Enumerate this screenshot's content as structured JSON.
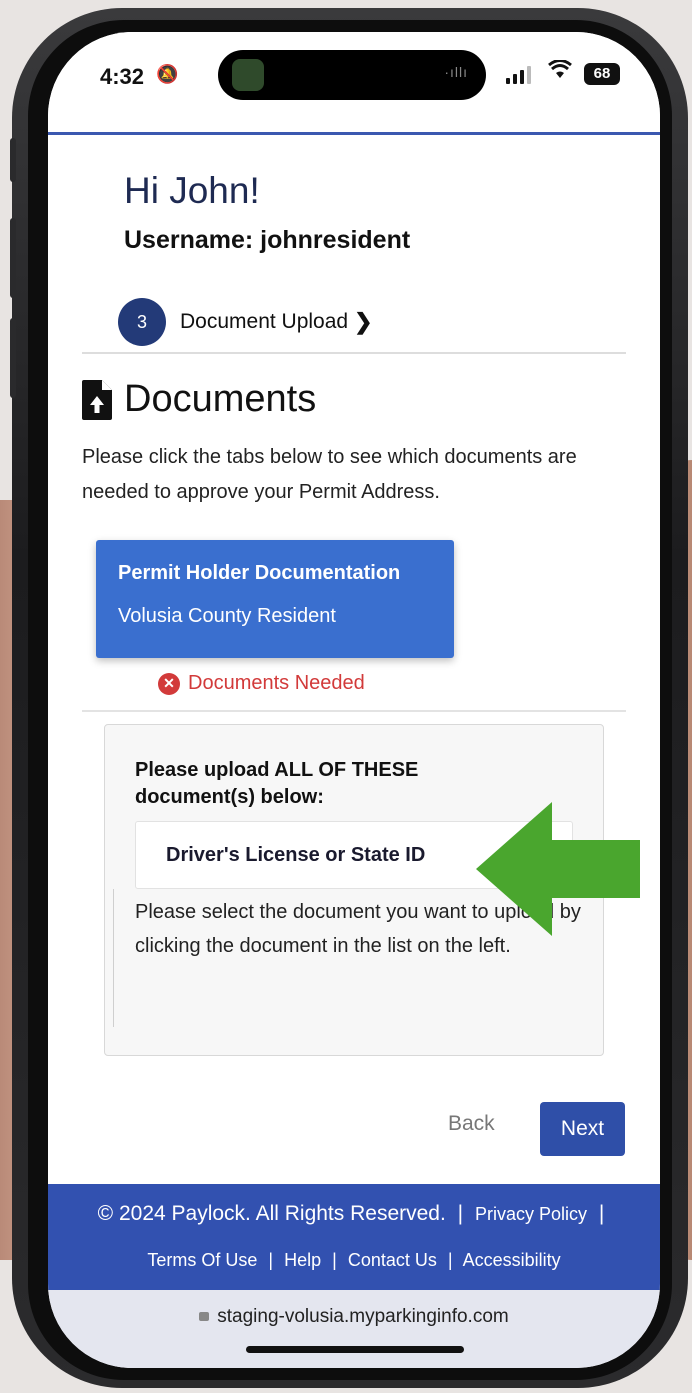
{
  "status_bar": {
    "time": "4:32",
    "battery": "68"
  },
  "header": {
    "greeting": "Hi John!",
    "username": "Username: johnresident"
  },
  "stepper": {
    "step_number": "3",
    "step_label": "Document Upload",
    "chevron": "❯"
  },
  "documents": {
    "title": "Documents",
    "instructions": "Please click the tabs below to see which documents are needed to approve your Permit Address.",
    "tab": {
      "title": "Permit Holder Documentation",
      "subtitle": "Volusia County Resident"
    },
    "status": "Documents Needed",
    "status_color": "#d23a3a",
    "upload_heading": "Please upload ALL OF THESE document(s) below:",
    "items": [
      "Driver's License or State ID"
    ],
    "select_hint": "Please select the document you want to upload by clicking the document in the list on the left."
  },
  "actions": {
    "back_label": "Back",
    "next_label": "Next"
  },
  "footer": {
    "copyright": "© 2024 Paylock. All Rights Reserved.",
    "privacy": "Privacy Policy",
    "terms": "Terms Of Use",
    "help": "Help",
    "contact": "Contact Us",
    "accessibility": "Accessibility"
  },
  "browser": {
    "url": "staging-volusia.myparkinginfo.com"
  },
  "colors": {
    "brand_blue": "#3251b0",
    "tab_blue": "#3a6fcf",
    "annotation_arrow": "#4aa62e"
  },
  "icons": {
    "silent": "bell-slash-icon",
    "wifi": "wifi-icon",
    "document": "file-upload-icon",
    "error": "x-circle-icon",
    "lock": "lock-icon",
    "arrow": "green-arrow-left"
  }
}
